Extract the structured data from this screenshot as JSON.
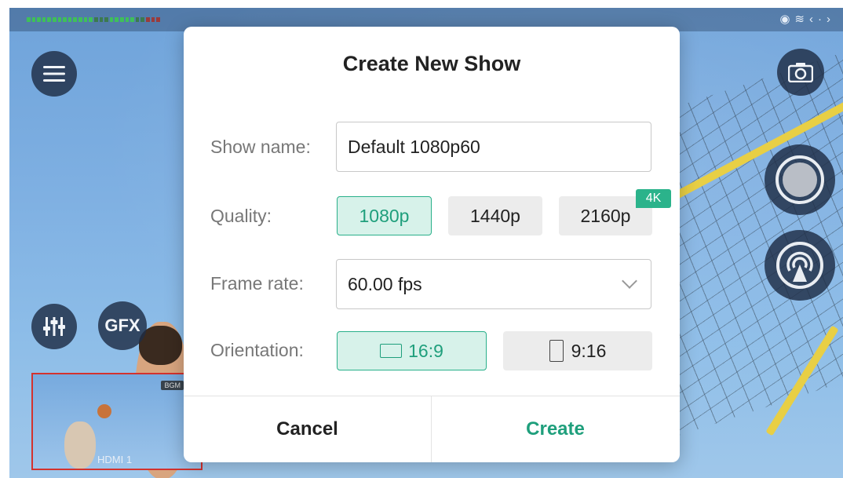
{
  "dialog": {
    "title": "Create New Show",
    "show_name_label": "Show name:",
    "show_name_value": "Default 1080p60",
    "quality_label": "Quality:",
    "quality_options": [
      "1080p",
      "1440p",
      "2160p"
    ],
    "quality_selected": "1080p",
    "quality_badge": "4K",
    "frame_rate_label": "Frame rate:",
    "frame_rate_value": "60.00 fps",
    "orientation_label": "Orientation:",
    "orientation_options": [
      "16:9",
      "9:16"
    ],
    "orientation_selected": "16:9",
    "cancel_label": "Cancel",
    "create_label": "Create"
  },
  "background": {
    "gfx_label": "GFX",
    "thumbnail_label": "HDMI 1",
    "bgm_label": "BGM"
  },
  "colors": {
    "accent": "#2bb38b",
    "selected_fill": "#d7f2ea",
    "thumbnail_border": "#d3322e"
  }
}
